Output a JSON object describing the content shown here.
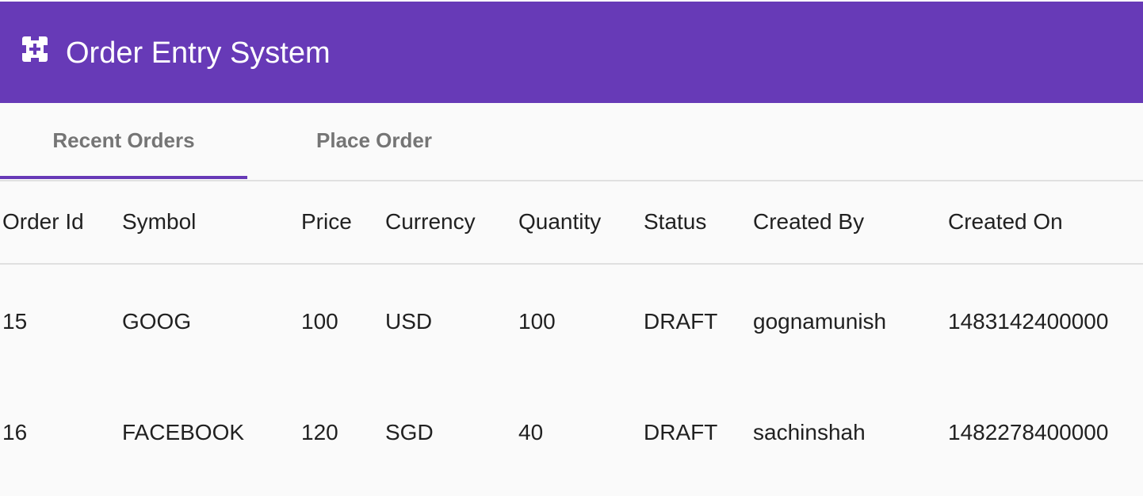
{
  "toolbar": {
    "icon": "app-grid-icon",
    "title": "Order Entry System",
    "background_color": "#673ab7"
  },
  "tabs": [
    {
      "label": "Recent Orders",
      "active": true
    },
    {
      "label": "Place Order",
      "active": false
    }
  ],
  "table": {
    "columns": [
      "Order Id",
      "Symbol",
      "Price",
      "Currency",
      "Quantity",
      "Status",
      "Created By",
      "Created On"
    ],
    "rows": [
      [
        "15",
        "GOOG",
        "100",
        "USD",
        "100",
        "DRAFT",
        "gognamunish",
        "1483142400000"
      ],
      [
        "16",
        "FACEBOOK",
        "120",
        "SGD",
        "40",
        "DRAFT",
        "sachinshah",
        "1482278400000"
      ]
    ]
  }
}
